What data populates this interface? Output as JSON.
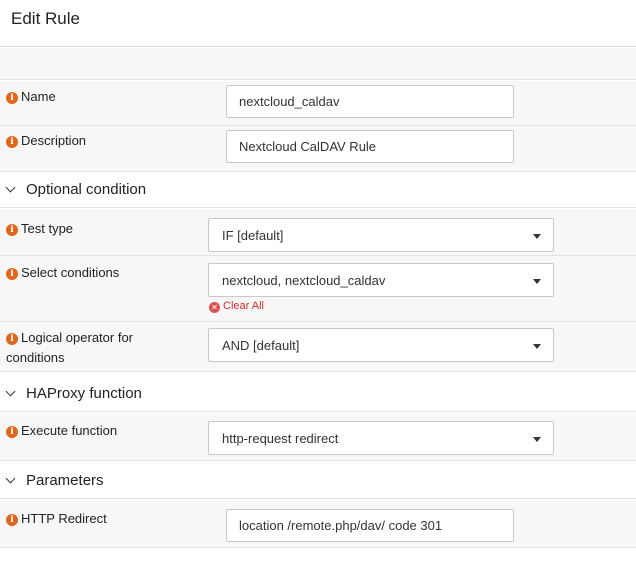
{
  "header": {
    "title": "Edit Rule"
  },
  "fields": {
    "name": {
      "label": "Name",
      "value": "nextcloud_caldav"
    },
    "description": {
      "label": "Description",
      "value": "Nextcloud CalDAV Rule"
    }
  },
  "sections": {
    "optional_condition": {
      "title": "Optional condition",
      "test_type": {
        "label": "Test type",
        "value": "IF [default]"
      },
      "select_conditions": {
        "label": "Select conditions",
        "value": "nextcloud, nextcloud_caldav",
        "clear_all": "Clear All"
      },
      "logical_operator": {
        "label_line1": "Logical operator for",
        "label_line2": "conditions",
        "value": "AND [default]"
      }
    },
    "haproxy_function": {
      "title": "HAProxy function",
      "execute_function": {
        "label": "Execute function",
        "value": "http-request redirect"
      }
    },
    "parameters": {
      "title": "Parameters",
      "http_redirect": {
        "label": "HTTP Redirect",
        "value": "location /remote.php/dav/ code 301"
      }
    }
  },
  "icons": {
    "info": "info-icon",
    "clear": "clear-x-icon",
    "chevron": "chevron-down-icon",
    "caret": "caret-down-icon"
  },
  "colors": {
    "info": "#e0661b",
    "clear": "#d9534f"
  }
}
